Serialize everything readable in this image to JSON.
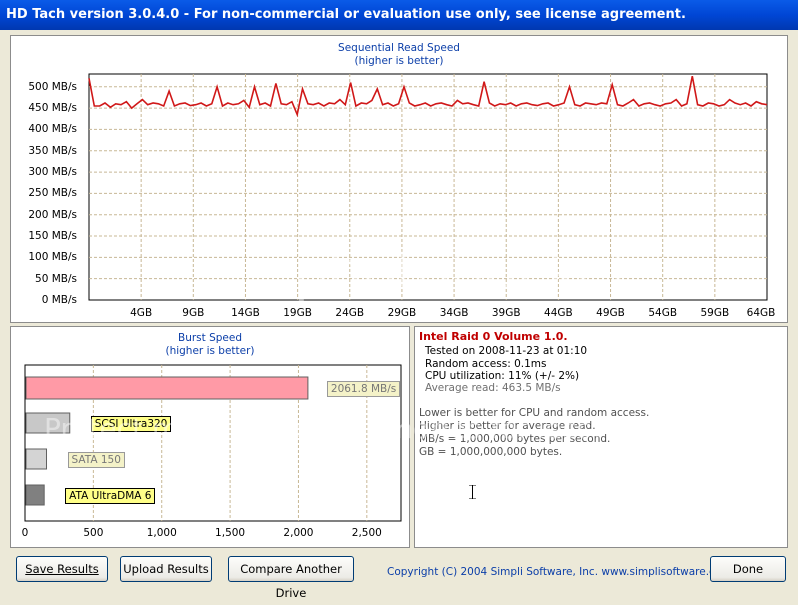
{
  "window": {
    "title": "HD Tach version 3.0.4.0  - For non-commercial or evaluation use only, see license agreement."
  },
  "seq_chart": {
    "title_line1": "Sequential Read Speed",
    "title_line2": "(higher is better)",
    "y_ticks": [
      "500 MB/s",
      "450 MB/s",
      "400 MB/s",
      "350 MB/s",
      "300 MB/s",
      "250 MB/s",
      "200 MB/s",
      "150 MB/s",
      "100 MB/s",
      "50 MB/s",
      "0 MB/s"
    ],
    "x_ticks": [
      "4GB",
      "9GB",
      "14GB",
      "19GB",
      "24GB",
      "29GB",
      "34GB",
      "39GB",
      "44GB",
      "49GB",
      "54GB",
      "59GB",
      "64GB"
    ],
    "line_color": "#d01818",
    "grid_color": "#c8b896"
  },
  "burst_chart": {
    "title_line1": "Burst Speed",
    "title_line2": "(higher is better)",
    "x_ticks": [
      "0",
      "500",
      "1,000",
      "1,500",
      "2,000",
      "2,500"
    ]
  },
  "info": {
    "heading": "Intel Raid 0 Volume 1.0.",
    "tested_on": "Tested on 2008-11-23 at 01:10",
    "random_access": "Random access: 0.1ms",
    "cpu_util": "CPU utilization: 11% (+/- 2%)",
    "avg_read": "Average read: 463.5 MB/s",
    "note1": "Lower is better for CPU and random access.",
    "note2": "Higher is better for average read.",
    "note3": "MB/s = 1,000,000 bytes per second.",
    "note4": "GB = 1,000,000,000 bytes."
  },
  "buttons": {
    "save": "Save Results",
    "upload": "Upload Results",
    "compare": "Compare Another Drive",
    "done": "Done"
  },
  "copyright": "Copyright (C) 2004 Simpli Software, Inc. www.simplisoftware.com",
  "watermark": {
    "main": "photobucket",
    "sub": "Protect more of your memories for less!"
  },
  "chart_data": [
    {
      "type": "line",
      "title": "Sequential Read Speed",
      "xlabel": "",
      "ylabel": "",
      "xlim": [
        0,
        64
      ],
      "ylim": [
        0,
        530
      ],
      "grid": true,
      "series": [
        {
          "values": [
            520,
            455,
            455,
            462,
            452,
            460,
            458,
            465,
            450,
            460,
            470,
            458,
            462,
            460,
            455,
            490,
            455,
            460,
            462,
            456,
            458,
            462,
            455,
            460,
            500,
            455,
            462,
            458,
            460,
            468,
            452,
            500,
            458,
            462,
            455,
            508,
            460,
            458,
            465,
            435,
            495,
            460,
            458,
            462,
            455,
            462,
            460,
            470,
            458,
            510,
            455,
            462,
            460,
            468,
            495,
            458,
            462,
            455,
            460,
            500,
            462,
            455,
            458,
            462,
            455,
            460,
            462,
            458,
            455,
            468,
            460,
            462,
            458,
            455,
            512,
            462,
            455,
            460,
            458,
            462,
            455,
            460,
            462,
            458,
            456,
            460,
            462,
            455,
            458,
            462,
            500,
            458,
            455,
            462,
            460,
            458,
            462,
            460,
            505,
            458,
            455,
            462,
            470,
            455,
            460,
            462,
            458,
            455,
            460,
            462,
            470,
            455,
            460,
            525,
            458,
            455,
            462,
            460,
            455,
            458,
            470,
            462,
            458,
            462,
            455,
            465,
            460,
            458
          ]
        }
      ]
    },
    {
      "type": "bar",
      "title": "Burst Speed",
      "xlim": [
        0,
        2750
      ],
      "categories": [
        "Intel Raid 0 Volume",
        "SCSI Ultra320",
        "SATA 150",
        "ATA UltraDMA 6"
      ],
      "values": [
        2061.8,
        320,
        150,
        133
      ],
      "value_labels": [
        "2061.8 MB/s",
        "",
        "",
        ""
      ],
      "category_labels": [
        "",
        "SCSI Ultra320",
        "SATA 150",
        "ATA UltraDMA 6"
      ],
      "colors": [
        "#ff9aa6",
        "#c8c8c8",
        "#d4d4d4",
        "#808080"
      ]
    }
  ]
}
